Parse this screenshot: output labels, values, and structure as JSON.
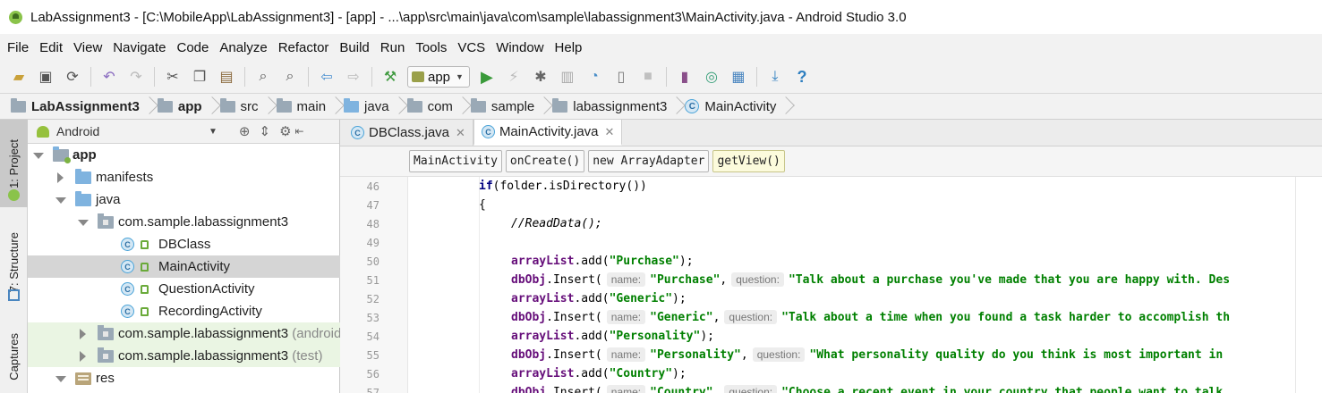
{
  "window": {
    "title": "LabAssignment3 - [C:\\MobileApp\\LabAssignment3] - [app] - ...\\app\\src\\main\\java\\com\\sample\\labassignment3\\MainActivity.java - Android Studio 3.0"
  },
  "menu": [
    "File",
    "Edit",
    "View",
    "Navigate",
    "Code",
    "Analyze",
    "Refactor",
    "Build",
    "Run",
    "Tools",
    "VCS",
    "Window",
    "Help"
  ],
  "toolbar": {
    "run_config": "app"
  },
  "navbar": {
    "crumbs": [
      "LabAssignment3",
      "app",
      "src",
      "main",
      "java",
      "com",
      "sample",
      "labassignment3",
      "MainActivity"
    ]
  },
  "left_stripe": {
    "tabs": [
      "1: Project",
      "7: Structure",
      "Captures"
    ]
  },
  "project_panel": {
    "view": "Android",
    "tree": [
      {
        "label": "app",
        "suffix": ""
      },
      {
        "label": "manifests",
        "suffix": ""
      },
      {
        "label": "java",
        "suffix": ""
      },
      {
        "label": "com.sample.labassignment3",
        "suffix": ""
      },
      {
        "label": "DBClass",
        "suffix": ""
      },
      {
        "label": "MainActivity",
        "suffix": ""
      },
      {
        "label": "QuestionActivity",
        "suffix": ""
      },
      {
        "label": "RecordingActivity",
        "suffix": ""
      },
      {
        "label": "com.sample.labassignment3",
        "suffix": "(androidTest)"
      },
      {
        "label": "com.sample.labassignment3",
        "suffix": "(test)"
      },
      {
        "label": "res",
        "suffix": ""
      }
    ]
  },
  "editor": {
    "tabs": [
      {
        "label": "DBClass.java",
        "active": false
      },
      {
        "label": "MainActivity.java",
        "active": true
      }
    ],
    "code_breadcrumbs": [
      "MainActivity",
      "onCreate()",
      "new ArrayAdapter",
      "getView()"
    ],
    "line_numbers": [
      "46",
      "47",
      "48",
      "49",
      "50",
      "51",
      "52",
      "53",
      "54",
      "55",
      "56",
      "57"
    ],
    "code": {
      "l46_kw": "if",
      "l46_rest": "(folder.isDirectory())",
      "l47": "{",
      "l48": "//ReadData();",
      "l50_field": "arrayList",
      "l50_rest": ".add(",
      "l50_str": "\"Purchase\"",
      "l50_end": ");",
      "l51_field": "dbObj",
      "l51_rest": ".Insert(",
      "l51_hint1": "name:",
      "l51_str1": "\"Purchase\"",
      "l51_hint2": "question:",
      "l51_str2": "\"Talk about a purchase you've made that you are happy with. Des",
      "l52_field": "arrayList",
      "l52_rest": ".add(",
      "l52_str": "\"Generic\"",
      "l52_end": ");",
      "l53_field": "dbObj",
      "l53_rest": ".Insert(",
      "l53_hint1": "name:",
      "l53_str1": "\"Generic\"",
      "l53_hint2": "question:",
      "l53_str2": "\"Talk about a time when you found a task harder to accomplish th",
      "l54_field": "arrayList",
      "l54_rest": ".add(",
      "l54_str": "\"Personality\"",
      "l54_end": ");",
      "l55_field": "dbObj",
      "l55_rest": ".Insert(",
      "l55_hint1": "name:",
      "l55_str1": "\"Personality\"",
      "l55_hint2": "question:",
      "l55_str2": "\"What personality quality do you think is most important in",
      "l56_field": "arrayList",
      "l56_rest": ".add(",
      "l56_str": "\"Country\"",
      "l56_end": ");",
      "l57_field": "dbObj",
      "l57_rest": ".Insert(",
      "l57_hint1": "name:",
      "l57_str1": "\"Country\"",
      "l57_hint2": "question:",
      "l57_str2": "\"Choose a recent event in your country that people want to talk"
    }
  }
}
